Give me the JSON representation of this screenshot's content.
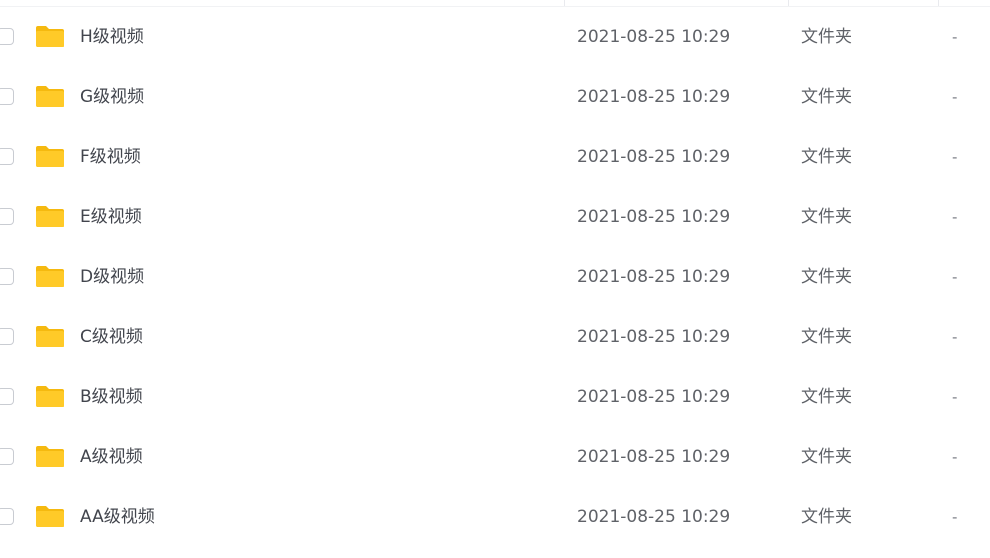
{
  "files": [
    {
      "name": "H级视频",
      "modified": "2021-08-25 10:29",
      "type": "文件夹",
      "size": "-"
    },
    {
      "name": "G级视频",
      "modified": "2021-08-25 10:29",
      "type": "文件夹",
      "size": "-"
    },
    {
      "name": "F级视频",
      "modified": "2021-08-25 10:29",
      "type": "文件夹",
      "size": "-"
    },
    {
      "name": "E级视频",
      "modified": "2021-08-25 10:29",
      "type": "文件夹",
      "size": "-"
    },
    {
      "name": "D级视频",
      "modified": "2021-08-25 10:29",
      "type": "文件夹",
      "size": "-"
    },
    {
      "name": "C级视频",
      "modified": "2021-08-25 10:29",
      "type": "文件夹",
      "size": "-"
    },
    {
      "name": "B级视频",
      "modified": "2021-08-25 10:29",
      "type": "文件夹",
      "size": "-"
    },
    {
      "name": "A级视频",
      "modified": "2021-08-25 10:29",
      "type": "文件夹",
      "size": "-"
    },
    {
      "name": "AA级视频",
      "modified": "2021-08-25 10:29",
      "type": "文件夹",
      "size": "-"
    }
  ],
  "icons": {
    "folder": "folder-icon",
    "checkbox": "checkbox-icon"
  },
  "colors": {
    "folder": "#ffca28",
    "folder_tab": "#f5b90f",
    "text": "#42454d",
    "muted": "#5f6268"
  }
}
